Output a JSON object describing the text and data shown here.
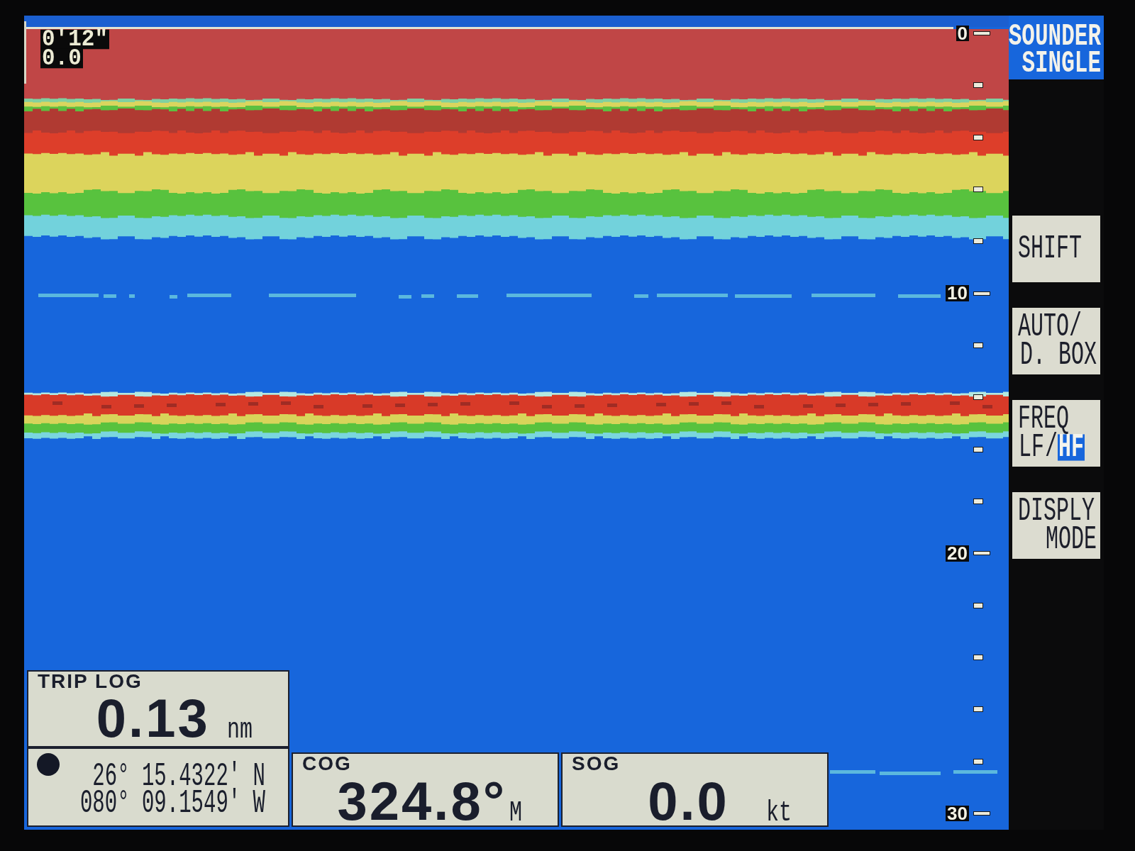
{
  "corner_readout": {
    "lines": [
      "0'12\"",
      "0.0"
    ]
  },
  "mode_label": {
    "lines": [
      "SOUNDER",
      "SINGLE"
    ]
  },
  "depth_scale": {
    "labels": [
      "0",
      "10",
      "20",
      "30"
    ]
  },
  "soft_keys": [
    {
      "kind": "text",
      "lines": [
        "SHIFT"
      ]
    },
    {
      "kind": "text",
      "lines": [
        "AUTO/",
        "D. BOX"
      ]
    },
    {
      "kind": "toggle",
      "lines": [
        "FREQ"
      ],
      "separator": "/",
      "options": [
        {
          "label": "LF",
          "selected": false
        },
        {
          "label": "HF",
          "selected": true
        }
      ]
    },
    {
      "kind": "text",
      "lines": [
        "DISPLY",
        "MODE"
      ]
    }
  ],
  "trip_log": {
    "label": "TRIP LOG",
    "value": "0.13",
    "unit": "nm"
  },
  "readouts": [
    {
      "kind": "position",
      "latitude": "26° 15.4322' N",
      "longitude": "080° 09.1549' W"
    },
    {
      "kind": "value",
      "label": "COG",
      "value": "324.8°",
      "unit": "M"
    },
    {
      "kind": "value",
      "label": "SOG",
      "value": "0.0",
      "unit": "kt"
    }
  ]
}
